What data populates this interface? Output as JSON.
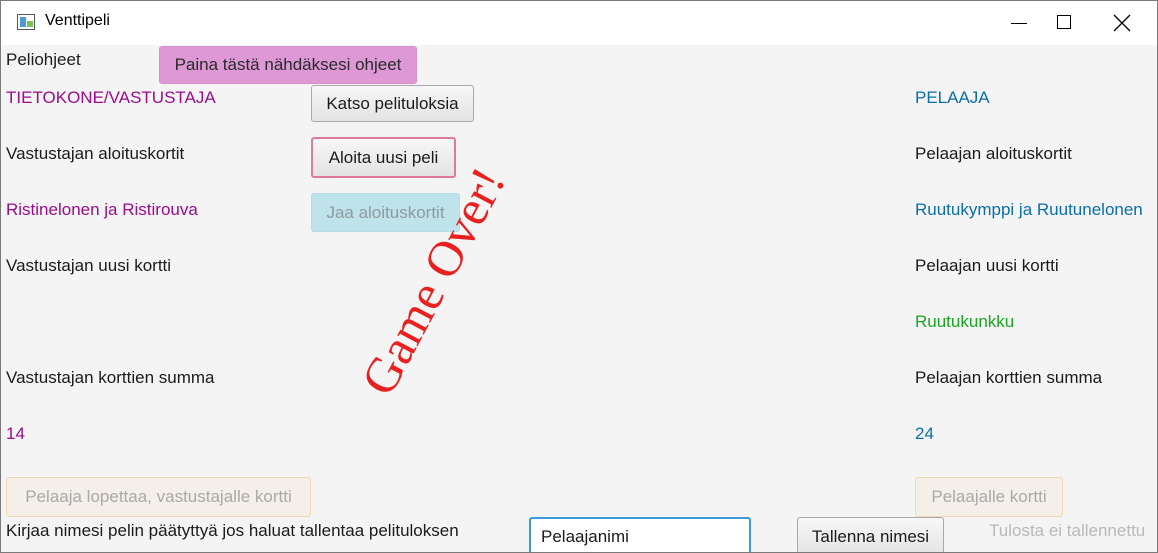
{
  "window": {
    "title": "Venttipeli",
    "controls": {
      "minimize": "minimize-icon",
      "maximize": "maximize-icon",
      "close": "close-icon"
    }
  },
  "instructions": {
    "label": "Peliohjeet",
    "button": "Paina tästä nähdäksesi ohjeet"
  },
  "opponent": {
    "heading": "TIETOKONE/VASTUSTAJA",
    "start_cards_label": "Vastustajan aloituskortit",
    "start_cards_value": "Ristinelonen ja Ristirouva",
    "new_card_label": "Vastustajan uusi kortti",
    "new_card_value": "",
    "sum_label": "Vastustajan korttien summa",
    "sum_value": "14",
    "button": "Pelaaja lopettaa, vastustajalle kortti"
  },
  "player": {
    "heading": "PELAAJA",
    "start_cards_label": "Pelaajan aloituskortit",
    "start_cards_value": "Ruutukymppi ja Ruutunelonen",
    "new_card_label": "Pelaajan uusi kortti",
    "new_card_value": "Ruutukunkku",
    "sum_label": "Pelaajan korttien summa",
    "sum_value": "24",
    "button": "Pelaajalle kortti"
  },
  "controls": {
    "results_button": "Katso pelituloksia",
    "new_game_button": "Aloita uusi peli",
    "deal_button": "Jaa aloituskortit"
  },
  "game_over_text": "Game Over!",
  "save": {
    "prompt": "Kirjaa nimesi pelin päätyttyä jos haluat tallentaa pelituloksen",
    "name_value": "Pelaajanimi",
    "button": "Tallenna nimesi",
    "status": "Tulosta ei tallennettu"
  },
  "colors": {
    "opponent_text": "#9b0b8e",
    "player_text": "#0a6ea8",
    "new_card_text": "#1aa520",
    "game_over": "#e8201f",
    "instructions_button": "#de98d6",
    "deal_button": "#bfe3ea"
  }
}
